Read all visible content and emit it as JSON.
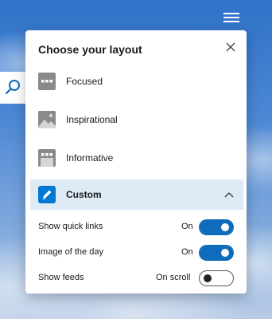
{
  "panel": {
    "title": "Choose your layout",
    "close_icon": "close-icon"
  },
  "layouts": [
    {
      "label": "Focused",
      "icon": "focused-layout-icon"
    },
    {
      "label": "Inspirational",
      "icon": "inspirational-layout-icon"
    },
    {
      "label": "Informative",
      "icon": "informative-layout-icon"
    }
  ],
  "custom": {
    "label": "Custom",
    "icon": "pencil-icon",
    "expanded_icon": "chevron-up-icon",
    "accent_color": "#0078d4",
    "selected_bg": "#deebf7"
  },
  "settings": [
    {
      "name": "Show quick links",
      "state": "On",
      "enabled": true
    },
    {
      "name": "Image of the day",
      "state": "On",
      "enabled": true
    },
    {
      "name": "Show feeds",
      "state": "On scroll",
      "enabled": false
    }
  ],
  "toggle_on_color": "#0f6cbd"
}
